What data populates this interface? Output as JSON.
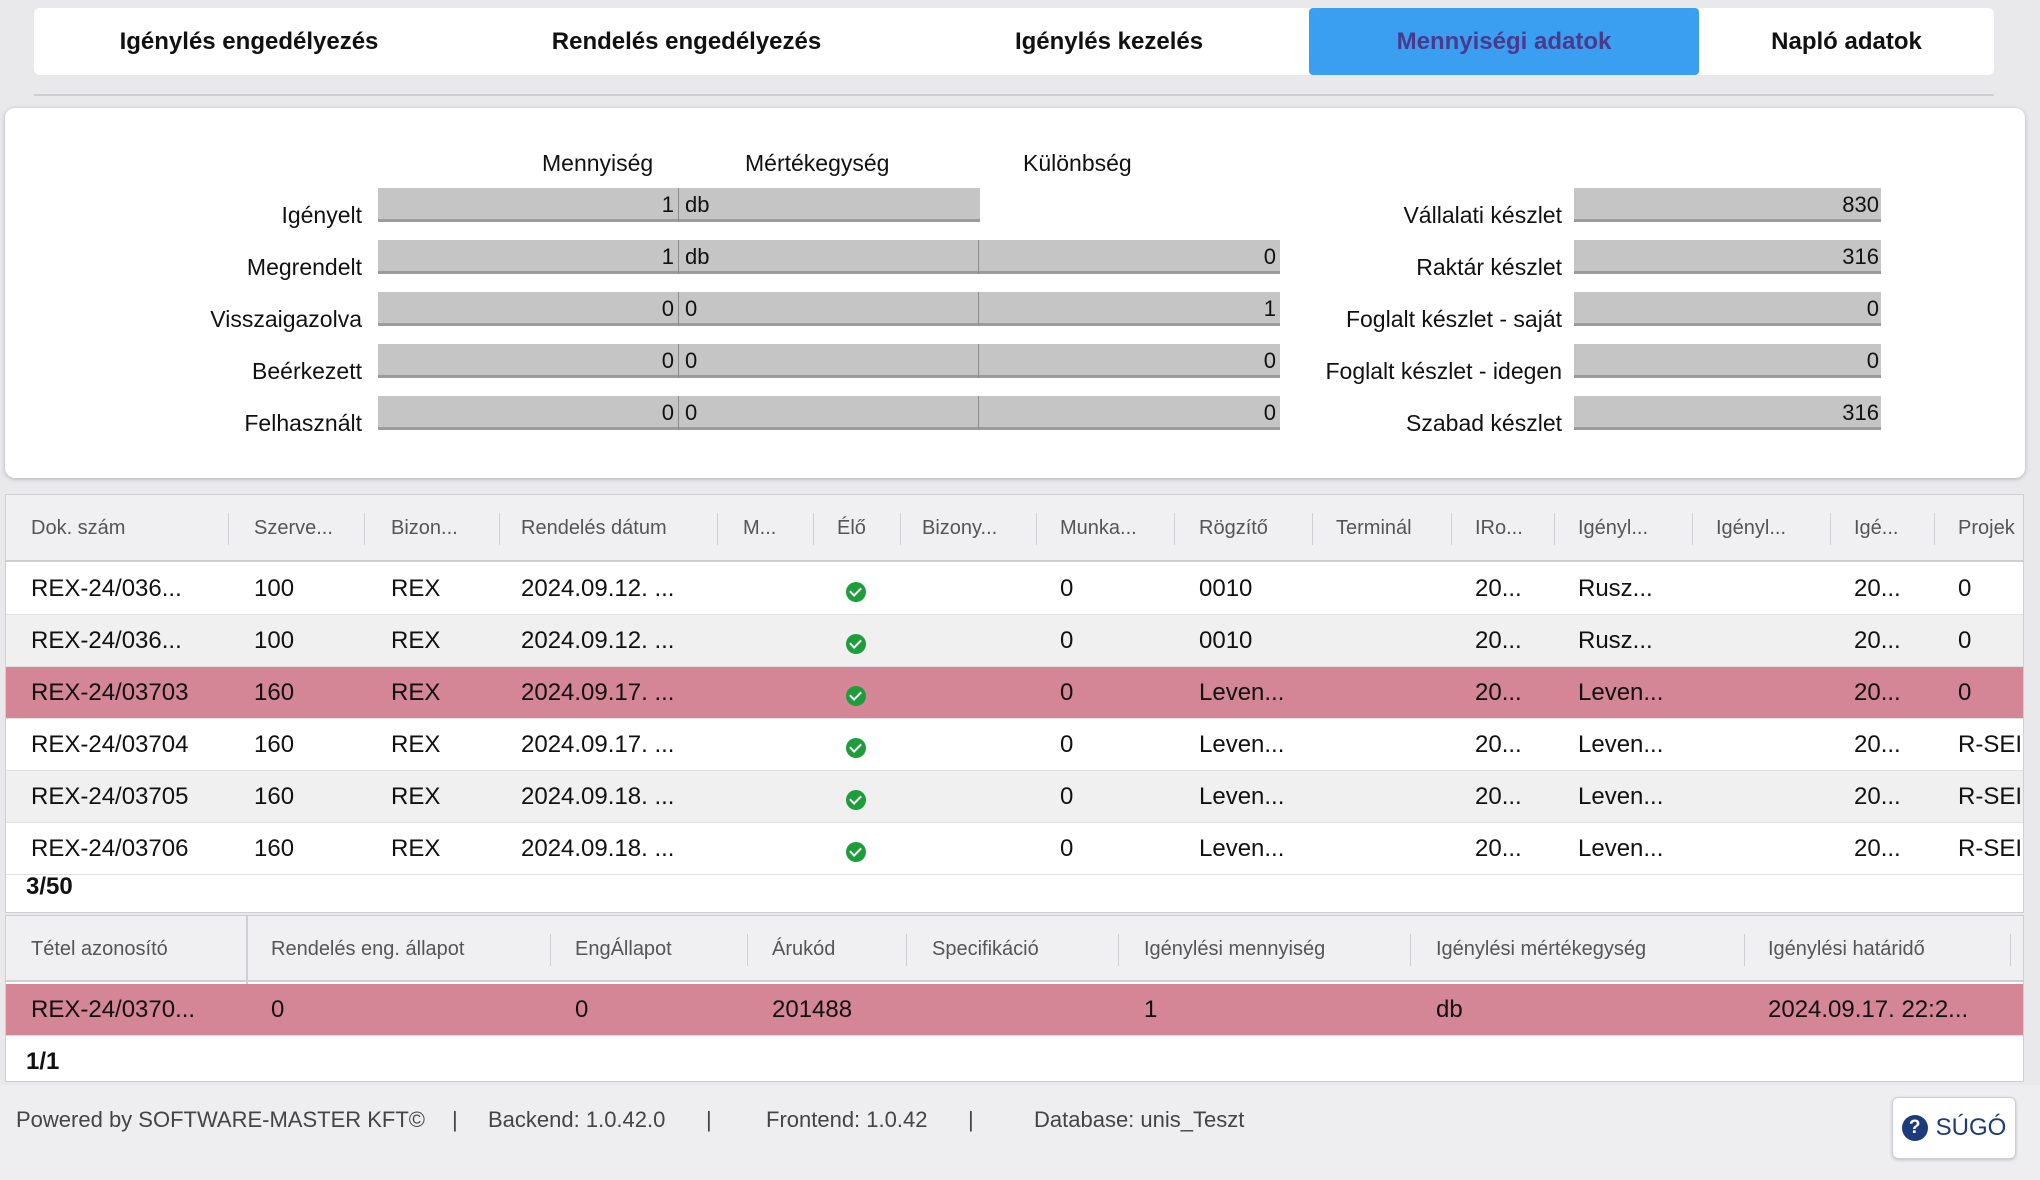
{
  "tabs": [
    {
      "label": "Igénylés engedélyezés"
    },
    {
      "label": "Rendelés engedélyezés"
    },
    {
      "label": "Igénylés kezelés"
    },
    {
      "label": "Mennyiségi adatok",
      "active": true
    },
    {
      "label": "Napló adatok"
    }
  ],
  "quantity": {
    "headers": {
      "mennyiseg": "Mennyiség",
      "mertekegyseg": "Mértékegység",
      "kulonbseg": "Különbség"
    },
    "rows": [
      {
        "label": "Igényelt",
        "qty": "1",
        "unit": "db",
        "diff": ""
      },
      {
        "label": "Megrendelt",
        "qty": "1",
        "unit": "db",
        "diff": "0"
      },
      {
        "label": "Visszaigazolva",
        "qty": "0",
        "unit": "0",
        "diff": "1"
      },
      {
        "label": "Beérkezett",
        "qty": "0",
        "unit": "0",
        "diff": "0"
      },
      {
        "label": "Felhasznált",
        "qty": "0",
        "unit": "0",
        "diff": "0"
      }
    ],
    "stock": [
      {
        "label": "Vállalati készlet",
        "value": "830"
      },
      {
        "label": "Raktár készlet",
        "value": "316"
      },
      {
        "label": "Foglalt készlet - saját",
        "value": "0"
      },
      {
        "label": "Foglalt készlet - idegen",
        "value": "0"
      },
      {
        "label": "Szabad készlet",
        "value": "316"
      }
    ]
  },
  "grid1": {
    "columns": [
      "Dok. szám",
      "Szerve...",
      "Bizon...",
      "Rendelés dátum",
      "M...",
      "Élő",
      "Bizony...",
      "Munka...",
      "Rögzítő",
      "Terminál",
      "IRo...",
      "Igényl...",
      "Igényl...",
      "Igé...",
      "Projek"
    ],
    "rows": [
      {
        "dok": "REX-24/036...",
        "szerv": "100",
        "bizon": "REX",
        "datum": "2024.09.12. ...",
        "munka": "0",
        "rogzito": "0010",
        "iro": "20...",
        "igenyl": "Rusz...",
        "ige": "20...",
        "projekt": "0",
        "style": "normal"
      },
      {
        "dok": "REX-24/036...",
        "szerv": "100",
        "bizon": "REX",
        "datum": "2024.09.12. ...",
        "munka": "0",
        "rogzito": "0010",
        "iro": "20...",
        "igenyl": "Rusz...",
        "ige": "20...",
        "projekt": "0",
        "style": "alt"
      },
      {
        "dok": "REX-24/03703",
        "szerv": "160",
        "bizon": "REX",
        "datum": "2024.09.17. ...",
        "munka": "0",
        "rogzito": "Leven...",
        "iro": "20...",
        "igenyl": "Leven...",
        "ige": "20...",
        "projekt": "0",
        "style": "selected"
      },
      {
        "dok": "REX-24/03704",
        "szerv": "160",
        "bizon": "REX",
        "datum": "2024.09.17. ...",
        "munka": "0",
        "rogzito": "Leven...",
        "iro": "20...",
        "igenyl": "Leven...",
        "ige": "20...",
        "projekt": "R-SEI",
        "style": "normal"
      },
      {
        "dok": "REX-24/03705",
        "szerv": "160",
        "bizon": "REX",
        "datum": "2024.09.18. ...",
        "munka": "0",
        "rogzito": "Leven...",
        "iro": "20...",
        "igenyl": "Leven...",
        "ige": "20...",
        "projekt": "R-SEI",
        "style": "alt"
      },
      {
        "dok": "REX-24/03706",
        "szerv": "160",
        "bizon": "REX",
        "datum": "2024.09.18. ...",
        "munka": "0",
        "rogzito": "Leven...",
        "iro": "20...",
        "igenyl": "Leven...",
        "ige": "20...",
        "projekt": "R-SEI",
        "style": "normal"
      }
    ],
    "pager": "3/50"
  },
  "grid2": {
    "columns": [
      "Tétel azonosító",
      "Rendelés eng. állapot",
      "EngÁllapot",
      "Árukód",
      "Specifikáció",
      "Igénylési mennyiség",
      "Igénylési mértékegység",
      "Igénylési határidő"
    ],
    "row": {
      "tetel": "REX-24/0370...",
      "rend_eng": "0",
      "eng": "0",
      "arukod": "201488",
      "spec": "",
      "menny": "1",
      "mertek": "db",
      "hatarido": "2024.09.17. 22:2..."
    },
    "pager": "1/1"
  },
  "footer": {
    "powered": "Powered by SOFTWARE-MASTER KFT©",
    "sep": "|",
    "backend": "Backend: 1.0.42.0",
    "frontend": "Frontend: 1.0.42",
    "database": "Database: unis_Teszt",
    "help_label": "SÚGÓ"
  },
  "colors": {
    "accent": "#3a9ff0",
    "selected_row": "#d48596",
    "ok_icon": "#1e9e3a"
  }
}
